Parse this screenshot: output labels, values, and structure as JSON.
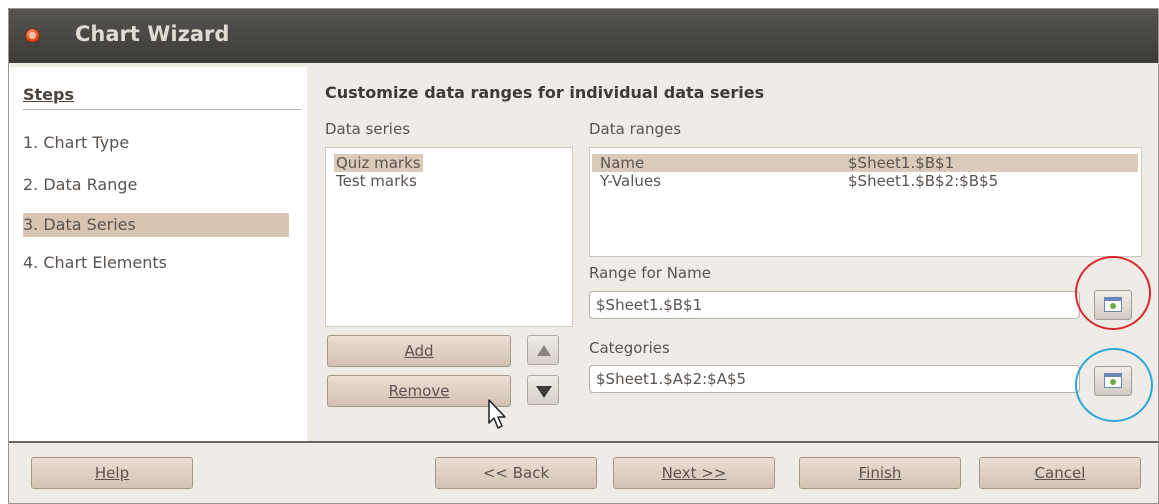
{
  "window": {
    "title": "Chart Wizard"
  },
  "steps": {
    "heading": "Steps",
    "items": [
      {
        "label": "1. Chart Type"
      },
      {
        "label": "2. Data Range"
      },
      {
        "label": "3. Data Series",
        "active": true
      },
      {
        "label": "4. Chart Elements"
      }
    ]
  },
  "main": {
    "title": "Customize data ranges for individual data series",
    "data_series_label": "Data series",
    "data_series": [
      "Quiz marks",
      "Test marks"
    ],
    "data_ranges_label": "Data ranges",
    "data_ranges": [
      {
        "name": "Name",
        "value": "$Sheet1.$B$1"
      },
      {
        "name": "Y-Values",
        "value": "$Sheet1.$B$2:$B$5"
      }
    ],
    "range_for_name_label": "Range for Name",
    "range_for_name_value": "$Sheet1.$B$1",
    "categories_label": "Categories",
    "categories_value": "$Sheet1.$A$2:$A$5",
    "add_label": "Add",
    "remove_label": "Remove"
  },
  "footer": {
    "help": "Help",
    "back": "<< Back",
    "next": "Next >>",
    "finish": "Finish",
    "cancel": "Cancel"
  },
  "icons": {
    "close": "close-icon",
    "move_up": "arrow-up-icon",
    "move_down": "arrow-down-icon",
    "range_picker": "select-range-icon",
    "cursor": "mouse-pointer-icon"
  },
  "colors": {
    "titlebar": "#3c3b37",
    "selection": "#dccbbb",
    "highlight_red": "#d8282c",
    "highlight_blue": "#2aa6d8"
  }
}
